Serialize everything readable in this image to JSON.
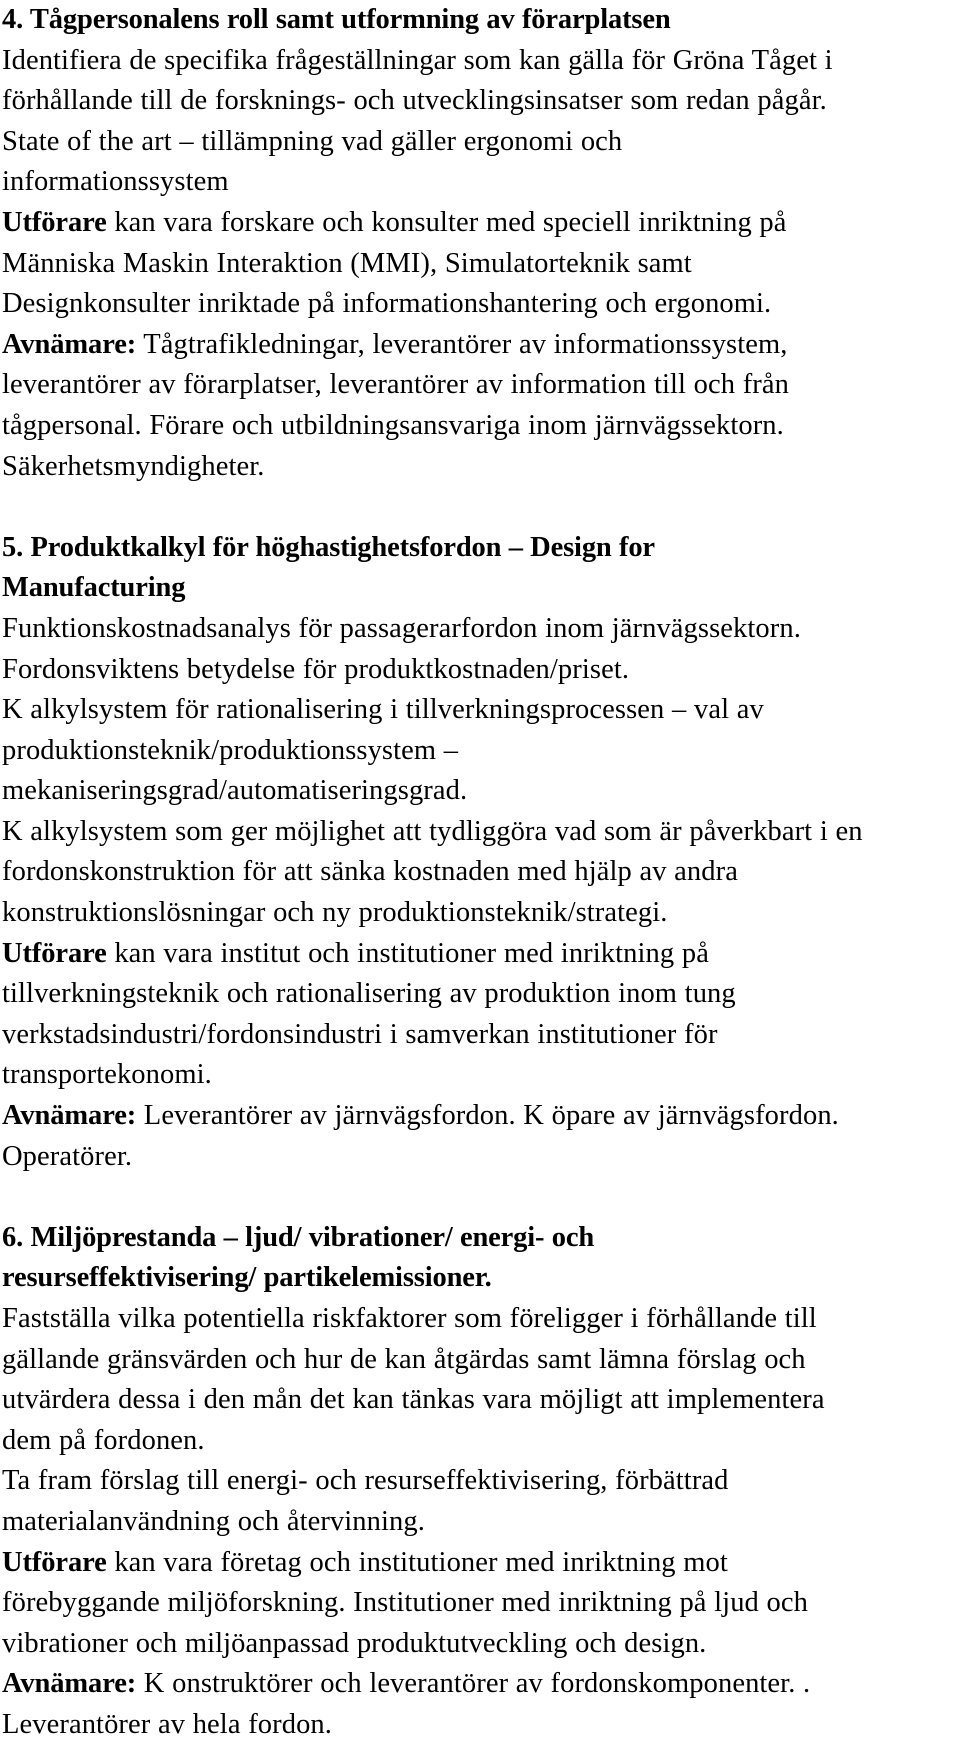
{
  "document": {
    "sections": [
      {
        "id": "section-4",
        "heading": "4. Tågpersonalens roll samt utformning av förarplatsen",
        "paragraphs": [
          {
            "id": "s4-p1",
            "lines": [
              "Identifiera de specifika frågeställningar som kan gälla för Gröna Tåget i",
              "förhållande till de forsknings- och utvecklingsinsatser som redan pågår."
            ]
          },
          {
            "id": "s4-p2",
            "lines": [
              "State of the art – tillämpning vad gäller ergonomi och",
              "informationssystem"
            ]
          },
          {
            "id": "s4-p3",
            "lead": "Utförare",
            "lead_trailing": " kan vara forskare och konsulter med speciell inriktning på",
            "lines": [
              "Människa Maskin Interaktion (MMI), Simulatorteknik samt",
              "Designkonsulter inriktade på informationshantering och ergonomi."
            ]
          },
          {
            "id": "s4-p4",
            "lead": "Avnämare:",
            "lead_trailing": " Tågtrafikledningar, leverantörer av informationssystem,",
            "lines": [
              "leverantörer av förarplatser, leverantörer av information till och från",
              "tågpersonal. Förare och utbildningsansvariga inom järnvägssektorn.",
              "Säkerhetsmyndigheter."
            ]
          }
        ]
      },
      {
        "id": "section-5",
        "heading_lines": [
          "5. Produktkalkyl för höghastighetsfordon – Design for",
          "Manufacturing"
        ],
        "paragraphs": [
          {
            "id": "s5-p1",
            "lines": [
              "Funktionskostnadsanalys för passagerarfordon inom järnvägssektorn.",
              "Fordonsviktens betydelse för produktkostnaden/priset.",
              "K alkylsystem för rationalisering i tillverkningsprocessen – val av",
              "produktionsteknik/produktionssystem –",
              "mekaniseringsgrad/automatiseringsgrad.",
              "K alkylsystem som ger möjlighet att tydliggöra vad som är påverkbart i en",
              "fordonskonstruktion för att sänka kostnaden med hjälp av andra",
              "konstruktionslösningar och ny produktionsteknik/strategi."
            ]
          },
          {
            "id": "s5-p2",
            "lead": "Utförare",
            "lead_trailing": " kan vara institut och institutioner med inriktning på",
            "lines": [
              "tillverkningsteknik och rationalisering av produktion inom tung",
              "verkstadsindustri/fordonsindustri i samverkan institutioner för",
              "transportekonomi."
            ]
          },
          {
            "id": "s5-p3",
            "lead": "Avnämare:",
            "lead_trailing": " Leverantörer av järnvägsfordon. K öpare av järnvägsfordon.",
            "lines": [
              "Operatörer."
            ]
          }
        ]
      },
      {
        "id": "section-6",
        "heading_lines": [
          "6. Miljöprestanda – ljud/ vibrationer/ energi- och",
          "resurseffektivisering/ partikelemissioner."
        ],
        "paragraphs": [
          {
            "id": "s6-p1",
            "lines": [
              "Fastställa vilka potentiella riskfaktorer som föreligger i förhållande till",
              "gällande gränsvärden och hur de kan åtgärdas samt lämna förslag och",
              "utvärdera dessa i den mån det kan tänkas vara möjligt att implementera",
              "dem på fordonen.",
              "Ta fram förslag till energi- och resurseffektivisering, förbättrad",
              "materialanvändning och återvinning."
            ]
          },
          {
            "id": "s6-p2",
            "lead": "Utförare",
            "lead_trailing": " kan vara företag och institutioner med inriktning mot",
            "lines": [
              "förebyggande miljöforskning. Institutioner med inriktning på ljud och",
              "vibrationer och miljöanpassad produktutveckling och design."
            ]
          },
          {
            "id": "s6-p3",
            "lead": "Avnämare:",
            "lead_trailing": " K onstruktörer och leverantörer av fordonskomponenter. .",
            "lines": [
              "Leverantörer av hela fordon."
            ]
          }
        ]
      }
    ]
  }
}
